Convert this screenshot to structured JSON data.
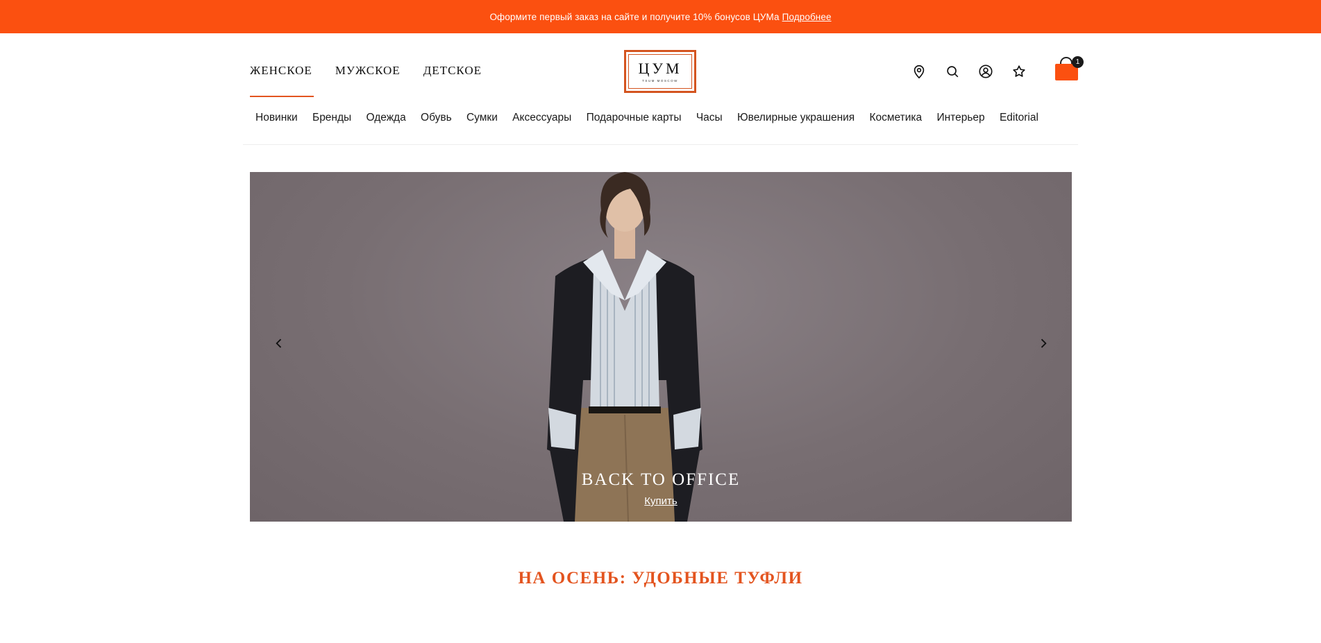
{
  "promo": {
    "text": "Оформите первый заказ на сайте и получите 10% бонусов ЦУМа",
    "link": "Подробнее"
  },
  "header": {
    "gender_tabs": [
      {
        "label": "ЖЕНСКОЕ",
        "active": true
      },
      {
        "label": "МУЖСКОЕ",
        "active": false
      },
      {
        "label": "ДЕТСКОЕ",
        "active": false
      }
    ],
    "logo": {
      "word": "ЦУМ",
      "subtitle": "TSUM MOSCOW"
    },
    "icons": [
      "location-icon",
      "search-icon",
      "account-icon",
      "favorites-icon",
      "cart-icon"
    ],
    "cart_count": "1"
  },
  "categories": [
    "Новинки",
    "Бренды",
    "Одежда",
    "Обувь",
    "Сумки",
    "Аксессуары",
    "Подарочные карты",
    "Часы",
    "Ювелирные украшения",
    "Косметика",
    "Интерьер",
    "Editorial"
  ],
  "hero": {
    "title": "BACK TO OFFICE",
    "cta": "Купить"
  },
  "section": {
    "title": "НА ОСЕНЬ: УДОБНЫЕ ТУФЛИ"
  },
  "colors": {
    "accent": "#fb5010",
    "heading": "#e3541f",
    "hero_bg": "#786e72"
  }
}
